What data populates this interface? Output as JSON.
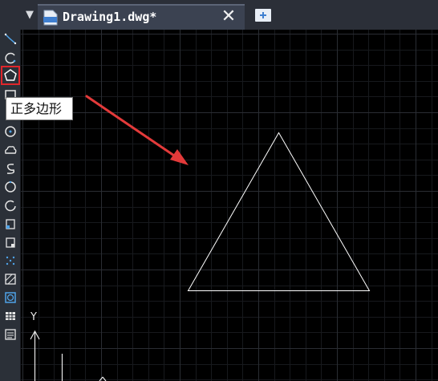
{
  "tab": {
    "title": "Drawing1.dwg*",
    "close_label": "✕"
  },
  "tooltip": {
    "text": "正多边形"
  },
  "toolbar": {
    "tools": [
      "line-icon",
      "polyline-icon",
      "arc-icon",
      "polygon-icon",
      "rectangle-icon",
      "freehand-icon",
      "circle-icon",
      "revision-cloud-icon",
      "spline-icon",
      "ellipse-icon",
      "ellipse-arc-icon",
      "insert-block-icon",
      "make-block-icon",
      "point-icon",
      "hatch-icon",
      "region-icon",
      "table-icon",
      "multiline-text-icon"
    ],
    "active_tool": "polygon-icon"
  },
  "ucs": {
    "y_label": "Y"
  },
  "colors": {
    "background": "#000000",
    "grid_minor": "#1b1d21",
    "grid_major": "#2e3137",
    "highlight": "#e0262b",
    "arrow": "#e33a3a"
  }
}
